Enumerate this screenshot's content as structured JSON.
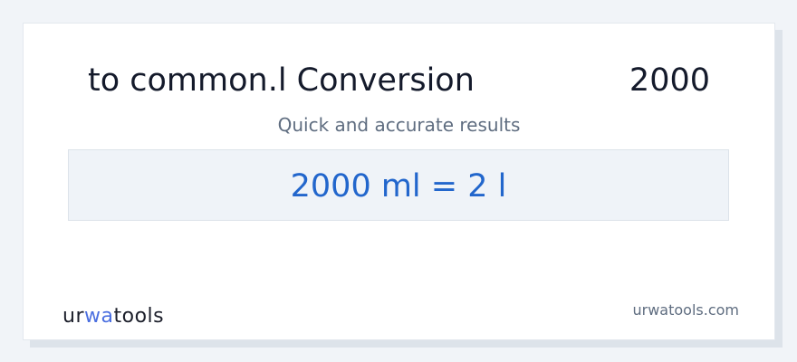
{
  "card": {
    "title": "to common.l Conversion",
    "value": "2000",
    "subtitle": "Quick and accurate results",
    "result": "2000 ml = 2 l"
  },
  "footer": {
    "logo": {
      "part1": "ur",
      "part2": "wa",
      "part3": "tools"
    },
    "domain": "urwatools.com"
  },
  "colors": {
    "accent": "#2266cc",
    "logo_accent": "#4b6fe0",
    "text_dark": "#141a2b",
    "text_muted": "#5f6d80",
    "result_bg": "#eff3f8"
  }
}
